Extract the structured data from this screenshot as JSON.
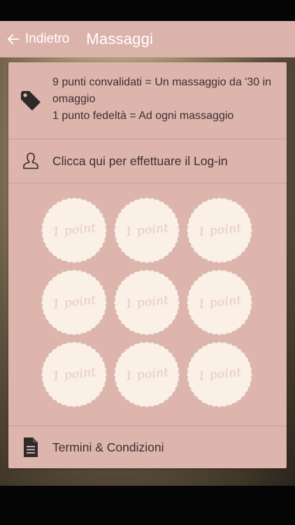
{
  "app_bar": {
    "back_label": "Indietro",
    "title": "Massaggi"
  },
  "card": {
    "promo": {
      "reward_text": "9 punti convalidati = Un massaggio da '30 in omaggio",
      "points_text": "1 punto fedeltà = Ad ogni massaggio"
    },
    "login": {
      "label": "Clicca qui per effettuare il Log-in"
    },
    "stamps": {
      "total": 9,
      "validated": 0,
      "items": [
        {
          "label": "1 point"
        },
        {
          "label": "1 point"
        },
        {
          "label": "1 point"
        },
        {
          "label": "1 point"
        },
        {
          "label": "1 point"
        },
        {
          "label": "1 point"
        },
        {
          "label": "1 point"
        },
        {
          "label": "1 point"
        },
        {
          "label": "1 point"
        }
      ]
    },
    "terms": {
      "label": "Termini & Condizioni"
    }
  },
  "colors": {
    "app_bar": "#dcb3aa",
    "card_background": "#deb5ac",
    "stamp_fill": "#faf0e6",
    "stamp_text": "#e8c9bd",
    "text": "#3a3030"
  },
  "icons": {
    "back": "arrow-left-icon",
    "promo": "price-tag-icon",
    "login": "user-outline-icon",
    "terms": "document-icon"
  }
}
